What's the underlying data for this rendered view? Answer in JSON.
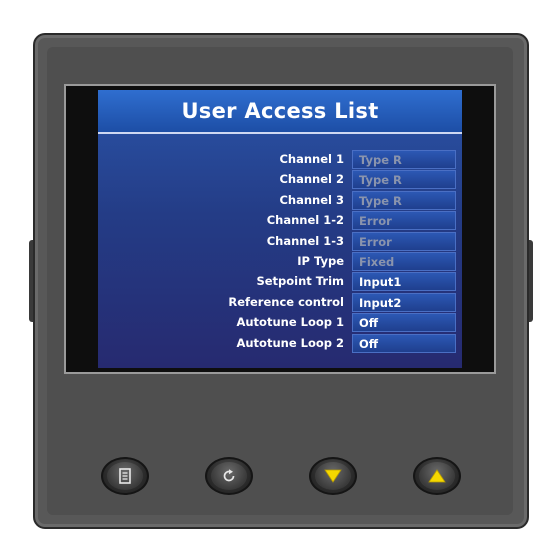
{
  "screen": {
    "title": "User Access List",
    "rows": [
      {
        "label": "Channel 1",
        "value": "Type R",
        "state": "disabled"
      },
      {
        "label": "Channel 2",
        "value": "Type R",
        "state": "disabled"
      },
      {
        "label": "Channel 3",
        "value": "Type R",
        "state": "disabled"
      },
      {
        "label": "Channel 1-2",
        "value": "Error",
        "state": "disabled"
      },
      {
        "label": "Channel 1-3",
        "value": "Error",
        "state": "disabled"
      },
      {
        "label": "IP Type",
        "value": "Fixed",
        "state": "disabled"
      },
      {
        "label": "Setpoint Trim",
        "value": "Input1",
        "state": "enabled"
      },
      {
        "label": "Reference control",
        "value": "Input2",
        "state": "enabled"
      },
      {
        "label": "Autotune Loop 1",
        "value": "Off",
        "state": "enabled"
      },
      {
        "label": "Autotune Loop 2",
        "value": "Off",
        "state": "enabled"
      }
    ]
  },
  "keys": [
    {
      "name": "page-key",
      "icon": "page-icon"
    },
    {
      "name": "scroll-key",
      "icon": "scroll-icon"
    },
    {
      "name": "down-key",
      "icon": "down-arrow-icon"
    },
    {
      "name": "up-key",
      "icon": "up-arrow-icon"
    }
  ],
  "colors": {
    "screen_bg": "#243c86",
    "title_bar": "#1d4ea6",
    "bezel": "#585858",
    "arrow_key": "#f5d800",
    "disabled_text": "#8a94ad"
  }
}
